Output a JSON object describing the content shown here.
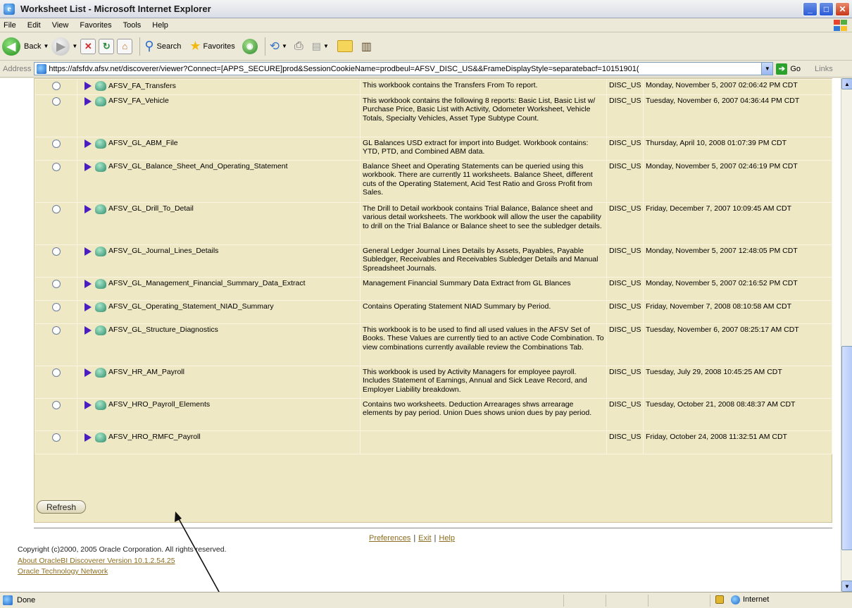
{
  "window": {
    "title": "Worksheet List - Microsoft Internet Explorer",
    "controls": [
      "_",
      "□",
      "✕"
    ]
  },
  "menu": [
    "File",
    "Edit",
    "View",
    "Favorites",
    "Tools",
    "Help"
  ],
  "toolbar": {
    "back_label": "Back",
    "search_label": "Search",
    "favorites_label": "Favorites"
  },
  "address": {
    "label": "Address",
    "url": "https://afsfdv.afsv.net/discoverer/viewer?Connect=[APPS_SECURE]prod&SessionCookieName=prodbeul=AFSV_DISC_US&&FrameDisplayStyle=separatebacf=10151901(",
    "go_label": "Go",
    "links_label": "Links"
  },
  "workbooks": [
    {
      "name": "AFSV_FA_Transfers",
      "description": "This workbook contains the Transfers From To report.",
      "db": "DISC_US",
      "date": "Monday, November 5, 2007 02:06:42 PM CDT"
    },
    {
      "name": "AFSV_FA_Vehicle",
      "description": "This workbook contains the following 8 reports: Basic List, Basic List w/ Purchase Price, Basic List with Activity, Odometer Worksheet, Vehicle Totals, Specialty Vehicles, Asset Type Subtype Count.",
      "db": "DISC_US",
      "date": "Tuesday, November 6, 2007 04:36:44 PM CDT"
    },
    {
      "name": "AFSV_GL_ABM_File",
      "description": "GL Balances USD extract for import into Budget. Workbook contains: YTD, PTD, and Combined ABM data.",
      "db": "DISC_US",
      "date": "Thursday, April 10, 2008 01:07:39 PM CDT"
    },
    {
      "name": "AFSV_GL_Balance_Sheet_And_Operating_Statement",
      "description": "Balance Sheet and Operating Statements can be queried using this workbook. There are currently 11 worksheets. Balance Sheet, different cuts of the Operating Statement, Acid Test Ratio and Gross Profit from Sales.",
      "db": "DISC_US",
      "date": "Monday, November 5, 2007 02:46:19 PM CDT"
    },
    {
      "name": "AFSV_GL_Drill_To_Detail",
      "description": "The Drill to Detail workbook contains Trial Balance, Balance sheet and various detail worksheets. The workbook will allow the user the capability to drill on the Trial Balance or Balance sheet to see the subledger details.",
      "db": "DISC_US",
      "date": "Friday, December 7, 2007 10:09:45 AM CDT"
    },
    {
      "name": "AFSV_GL_Journal_Lines_Details",
      "description": "General Ledger Journal Lines Details by Assets, Payables, Payable Subledger, Receivables and Receivables Subledger Details and Manual Spreadsheet Journals.",
      "db": "DISC_US",
      "date": "Monday, November 5, 2007 12:48:05 PM CDT"
    },
    {
      "name": "AFSV_GL_Management_Financial_Summary_Data_Extract",
      "description": "Management Financial Summary Data Extract from GL Blances",
      "db": "DISC_US",
      "date": "Monday, November 5, 2007 02:16:52 PM CDT"
    },
    {
      "name": "AFSV_GL_Operating_Statement_NIAD_Summary",
      "description": "Contains Operating Statement NIAD Summary by Period.",
      "db": "DISC_US",
      "date": "Friday, November 7, 2008 08:10:58 AM CDT"
    },
    {
      "name": "AFSV_GL_Structure_Diagnostics",
      "description": "This workbook is to be used to find all used values in the AFSV Set of Books. These Values are currently tied to an active Code Combination. To view combinations currently available review the Combinations Tab.",
      "db": "DISC_US",
      "date": "Tuesday, November 6, 2007 08:25:17 AM CDT"
    },
    {
      "name": "AFSV_HR_AM_Payroll",
      "description": "This workbook is used by Activity Managers for employee payroll. Includes Statement of Earnings, Annual and Sick Leave Record, and Employer Liability breakdown.",
      "db": "DISC_US",
      "date": "Tuesday, July 29, 2008 10:45:25 AM CDT"
    },
    {
      "name": "AFSV_HRO_Payroll_Elements",
      "description": "Contains two worksheets. Deduction Arrearages shws arrearage elements by pay period. Union Dues shows union dues by pay period.",
      "db": "DISC_US",
      "date": "Tuesday, October 21, 2008 08:48:37 AM CDT"
    },
    {
      "name": "AFSV_HRO_RMFC_Payroll",
      "description": "",
      "db": "DISC_US",
      "date": "Friday, October 24, 2008 11:32:51 AM CDT"
    }
  ],
  "refresh_label": "Refresh",
  "footer": {
    "preferences": "Preferences",
    "exit": "Exit",
    "help": "Help",
    "copyright": "Copyright (c)2000, 2005 Oracle Corporation. All rights reserved.",
    "about": "About OracleBI Discoverer Version 10.1.2.54.25",
    "otn": "Oracle Technology Network"
  },
  "status": {
    "text": "Done",
    "zone": "Internet"
  }
}
